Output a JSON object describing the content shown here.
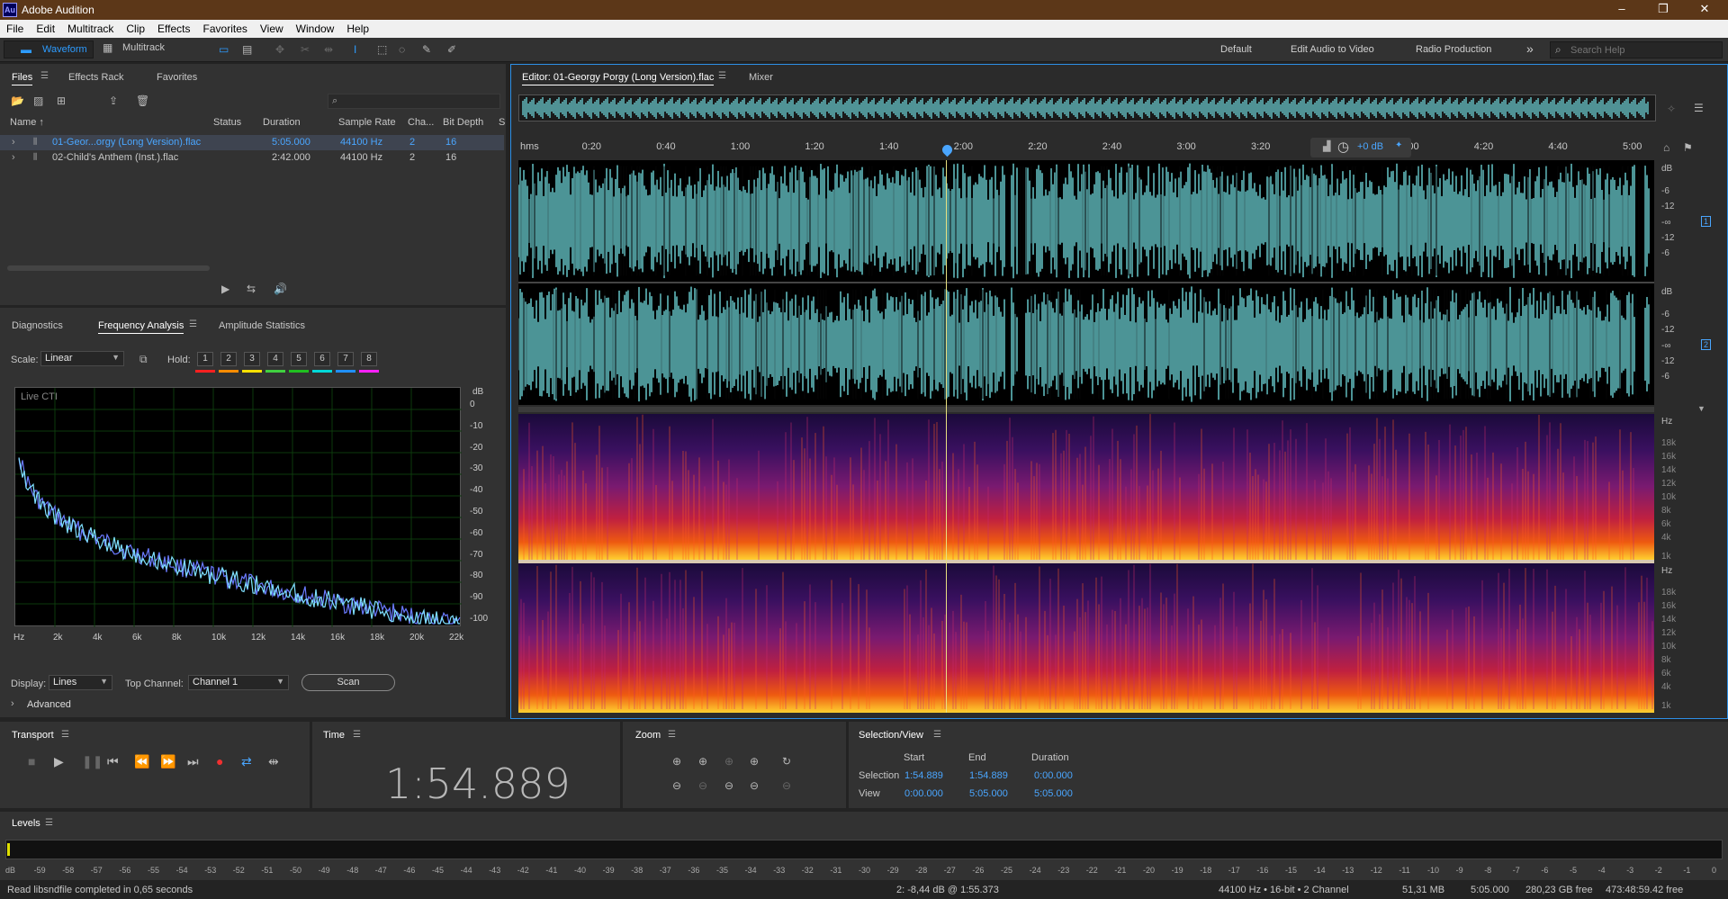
{
  "app": {
    "title": "Adobe Audition",
    "logo": "Au",
    "win_min": "–",
    "win_max": "❐",
    "win_close": "✕"
  },
  "menu": [
    "File",
    "Edit",
    "Multitrack",
    "Clip",
    "Effects",
    "Favorites",
    "View",
    "Window",
    "Help"
  ],
  "toolbar": {
    "waveform": "Waveform",
    "multitrack": "Multitrack",
    "workspaces": [
      "Default",
      "Edit Audio to Video",
      "Radio Production"
    ],
    "more": "»",
    "search_placeholder": "Search Help"
  },
  "files_panel": {
    "tabs": [
      "Files",
      "Effects Rack",
      "Favorites"
    ],
    "columns": [
      "Name ↑",
      "Status",
      "Duration",
      "Sample Rate",
      "Cha...",
      "Bit Depth",
      "S"
    ],
    "rows": [
      {
        "name": "01-Geor...orgy (Long Version).flac",
        "status": "",
        "duration": "5:05.000",
        "rate": "44100 Hz",
        "ch": "2",
        "depth": "16",
        "selected": true
      },
      {
        "name": "02-Child's Anthem (Inst.).flac",
        "status": "",
        "duration": "2:42.000",
        "rate": "44100 Hz",
        "ch": "2",
        "depth": "16",
        "selected": false
      }
    ]
  },
  "analysis_panel": {
    "tabs": [
      "Diagnostics",
      "Frequency Analysis",
      "Amplitude Statistics"
    ],
    "scale_label": "Scale:",
    "scale_value": "Linear",
    "hold_label": "Hold:",
    "holds": [
      "1",
      "2",
      "3",
      "4",
      "5",
      "6",
      "7",
      "8"
    ],
    "hold_colors": [
      "#ff2020",
      "#ff8c00",
      "#ffe000",
      "#40d040",
      "#20c020",
      "#00d8d8",
      "#2090ff",
      "#ff20ff"
    ],
    "plot_label": "Live CTI",
    "db_unit": "dB",
    "db_ticks": [
      "0",
      "-10",
      "-20",
      "-30",
      "-40",
      "-50",
      "-60",
      "-70",
      "-80",
      "-90",
      "-100"
    ],
    "hz_ticks": [
      "Hz",
      "2k",
      "4k",
      "6k",
      "8k",
      "10k",
      "12k",
      "14k",
      "16k",
      "18k",
      "20k",
      "22k"
    ],
    "display_label": "Display:",
    "display_value": "Lines",
    "top_channel_label": "Top Channel:",
    "top_channel_value": "Channel 1",
    "scan": "Scan",
    "advanced": "Advanced"
  },
  "editor": {
    "tab": "Editor: 01-Georgy Porgy (Long Version).flac",
    "mixer": "Mixer",
    "timeline": [
      "hms",
      "0:20",
      "0:40",
      "1:00",
      "1:20",
      "1:40",
      "2:00",
      "2:20",
      "2:40",
      "3:00",
      "3:20",
      "3:40",
      "4:00",
      "4:20",
      "4:40",
      "5:00"
    ],
    "gain": "+0 dB",
    "db_labels": [
      "dB",
      "-6",
      "-12",
      "-∞",
      "-12",
      "-6"
    ],
    "channels": [
      "1",
      "2"
    ],
    "hz_labels": [
      "Hz",
      "18k",
      "16k",
      "14k",
      "12k",
      "10k",
      "8k",
      "6k",
      "4k",
      "1k"
    ],
    "playhead_time": "1:54.889"
  },
  "transport": {
    "title": "Transport"
  },
  "time": {
    "title": "Time",
    "value": "1:54.889"
  },
  "zoom": {
    "title": "Zoom"
  },
  "selection": {
    "title": "Selection/View",
    "start": "Start",
    "end": "End",
    "duration": "Duration",
    "sel_label": "Selection",
    "view_label": "View",
    "sel_start": "1:54.889",
    "sel_end": "1:54.889",
    "sel_dur": "0:00.000",
    "view_start": "0:00.000",
    "view_end": "5:05.000",
    "view_dur": "5:05.000"
  },
  "levels": {
    "title": "Levels",
    "ticks": [
      "dB",
      "-59",
      "-58",
      "-57",
      "-56",
      "-55",
      "-54",
      "-53",
      "-52",
      "-51",
      "-50",
      "-49",
      "-48",
      "-47",
      "-46",
      "-45",
      "-44",
      "-43",
      "-42",
      "-41",
      "-40",
      "-39",
      "-38",
      "-37",
      "-36",
      "-35",
      "-34",
      "-33",
      "-32",
      "-31",
      "-30",
      "-29",
      "-28",
      "-27",
      "-26",
      "-25",
      "-24",
      "-23",
      "-22",
      "-21",
      "-20",
      "-19",
      "-18",
      "-17",
      "-16",
      "-15",
      "-14",
      "-13",
      "-12",
      "-11",
      "-10",
      "-9",
      "-8",
      "-7",
      "-6",
      "-5",
      "-4",
      "-3",
      "-2",
      "-1",
      "0"
    ]
  },
  "status": {
    "message": "Read libsndfile completed in 0,65 seconds",
    "cursor": "2: -8,44 dB @ 1:55.373",
    "format": "44100 Hz • 16-bit • 2 Channel",
    "size": "51,31 MB",
    "duration": "5:05.000",
    "free": "280,23 GB free",
    "free_time": "473:48:59.42 free"
  }
}
